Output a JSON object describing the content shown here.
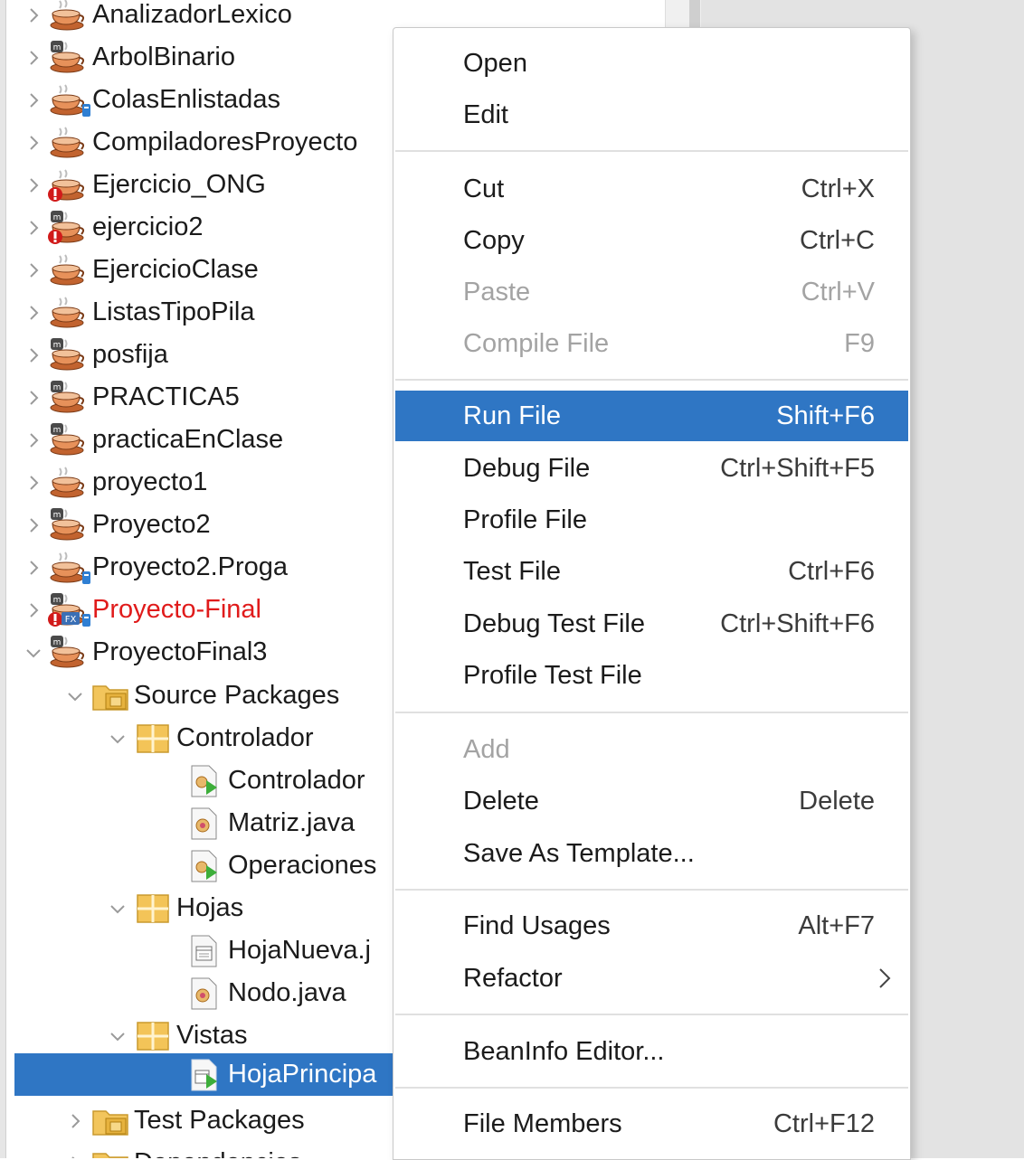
{
  "tree": {
    "projects": [
      {
        "label": "AnalizadorLexico",
        "icon": "java-project-icon"
      },
      {
        "label": "ArbolBinario",
        "icon": "maven-project-icon"
      },
      {
        "label": "ColasEnlistadas",
        "icon": "java-project-badge-icon"
      },
      {
        "label": "CompiladoresProyecto",
        "icon": "java-project-icon"
      },
      {
        "label": "Ejercicio_ONG",
        "icon": "java-project-error-icon"
      },
      {
        "label": "ejercicio2",
        "icon": "maven-project-error-icon"
      },
      {
        "label": "EjercicioClase",
        "icon": "java-project-icon"
      },
      {
        "label": "ListasTipoPila",
        "icon": "java-project-icon"
      },
      {
        "label": "posfija",
        "icon": "maven-project-icon"
      },
      {
        "label": "PRACTICA5",
        "icon": "maven-project-icon"
      },
      {
        "label": "practicaEnClase",
        "icon": "maven-project-icon"
      },
      {
        "label": "proyecto1",
        "icon": "java-project-icon"
      },
      {
        "label": "Proyecto2",
        "icon": "maven-project-icon"
      },
      {
        "label": "Proyecto2.Proga",
        "icon": "java-project-badge-icon"
      },
      {
        "label": "Proyecto-Final",
        "icon": "javafx-project-error-icon"
      },
      {
        "label": "ProyectoFinal3",
        "icon": "maven-project-icon"
      }
    ],
    "source_packages": "Source Packages",
    "pkg_controlador": "Controlador",
    "file_controlador": "Controlador",
    "file_matriz": "Matriz.java",
    "file_operaciones": "Operaciones",
    "pkg_hojas": "Hojas",
    "file_hojanueva": "HojaNueva.j",
    "file_nodo": "Nodo.java",
    "pkg_vistas": "Vistas",
    "file_hojaprincipal": "HojaPrincipa",
    "test_packages": "Test Packages",
    "dependencies": "Dependencies"
  },
  "menu": {
    "open": "Open",
    "edit": "Edit",
    "cut": "Cut",
    "cut_key": "Ctrl+X",
    "copy": "Copy",
    "copy_key": "Ctrl+C",
    "paste": "Paste",
    "paste_key": "Ctrl+V",
    "compile": "Compile File",
    "compile_key": "F9",
    "run": "Run File",
    "run_key": "Shift+F6",
    "debug": "Debug File",
    "debug_key": "Ctrl+Shift+F5",
    "profile": "Profile File",
    "test": "Test File",
    "test_key": "Ctrl+F6",
    "debug_test": "Debug Test File",
    "debug_test_key": "Ctrl+Shift+F6",
    "profile_test": "Profile Test File",
    "add": "Add",
    "delete": "Delete",
    "delete_key": "Delete",
    "save_template": "Save As Template...",
    "find_usages": "Find Usages",
    "find_usages_key": "Alt+F7",
    "refactor": "Refactor",
    "beaninfo": "BeanInfo Editor...",
    "file_members": "File Members",
    "file_members_key": "Ctrl+F12"
  },
  "colors": {
    "selection": "#2f76c4",
    "error_text": "#e01b1b",
    "disabled_text": "#a3a3a3"
  }
}
